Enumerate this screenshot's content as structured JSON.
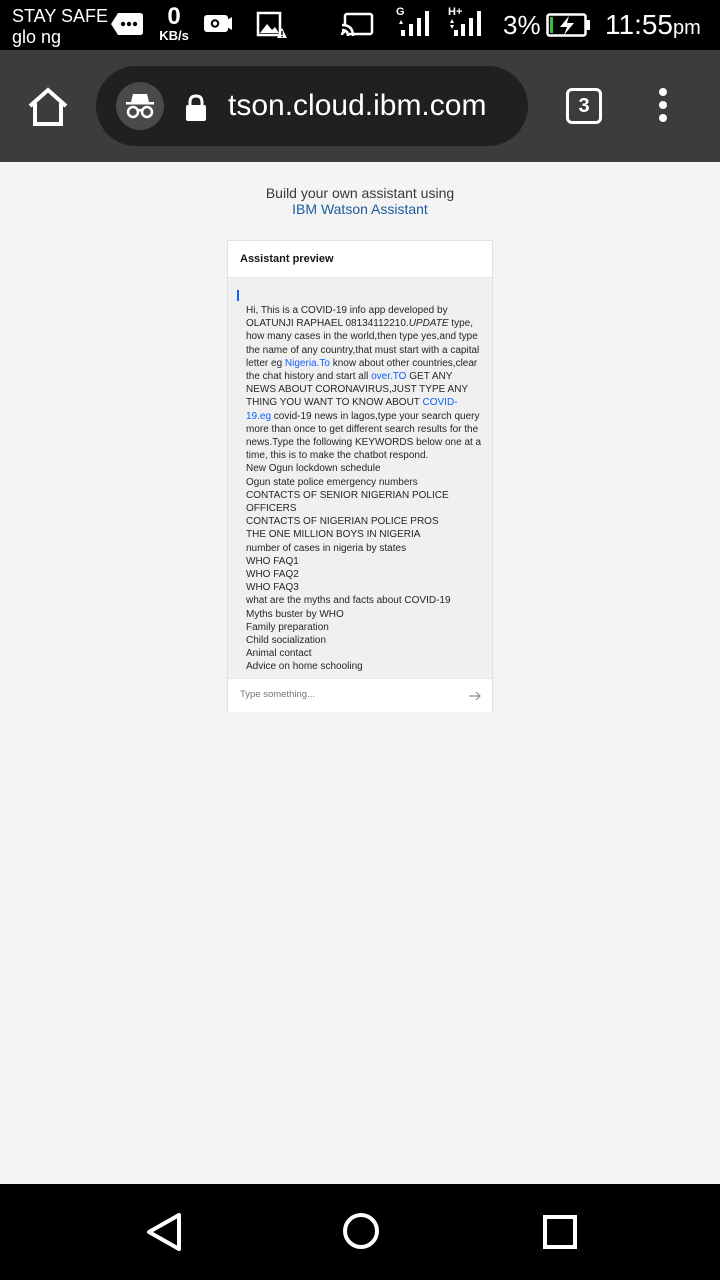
{
  "status_bar": {
    "carrier_line1": "STAY SAFE",
    "carrier_line2": "glo ng",
    "speed_value": "0",
    "speed_unit": "KB/s",
    "net1_label": "G",
    "net2_label": "H+",
    "battery_percent": "3%",
    "time": "11:55",
    "time_suffix": "pm"
  },
  "browser": {
    "url": "tson.cloud.ibm.com",
    "tab_count": "3"
  },
  "page": {
    "build_text": "Build your own assistant using",
    "build_link": "IBM Watson Assistant"
  },
  "preview": {
    "title": "Assistant preview",
    "msg_part1": "Hi, This is a COVID-19 info app developed by OLATUNJI RAPHAEL 08134112210.",
    "msg_italic": "UPDATE",
    "msg_part2": " type, how many cases in the world,then type yes,and type the name of any country,that must start with a capital letter eg ",
    "msg_link1": "Nigeria.To",
    "msg_part3": " know about other countries,clear the chat history and start all ",
    "msg_link2": "over.TO",
    "msg_part4": " GET ANY NEWS ABOUT CORONAVIRUS,JUST TYPE ANY THING YOU WANT TO KNOW ABOUT ",
    "msg_link3": "COVID-19.eg",
    "msg_part5": " covid-19 news in lagos,type your search query more than once to get different search results for the news.Type the following KEYWORDS below one at a time, this is to make the chatbot respond.",
    "keywords": [
      "New Ogun lockdown schedule",
      "Ogun state police emergency numbers",
      "CONTACTS OF SENIOR NIGERIAN POLICE OFFICERS",
      "CONTACTS OF NIGERIAN POLICE PROS",
      "THE ONE MILLION BOYS IN NIGERIA",
      "number of cases in nigeria by states",
      "WHO FAQ1",
      "WHO FAQ2",
      "WHO FAQ3",
      "what are the myths and facts about COVID-19",
      "Myths buster by WHO",
      "Family preparation",
      "Child socialization",
      "Animal contact",
      "Advice on home schooling"
    ],
    "input_placeholder": "Type something..."
  },
  "colors": {
    "link": "#0f62fe",
    "toolbar": "#3c3c3c",
    "page_bg": "#f4f4f4"
  },
  "icons": {
    "home": "home-icon",
    "incognito": "incognito-icon",
    "lock": "lock-icon",
    "menu": "more-vert-icon",
    "send": "arrow-right-icon"
  }
}
